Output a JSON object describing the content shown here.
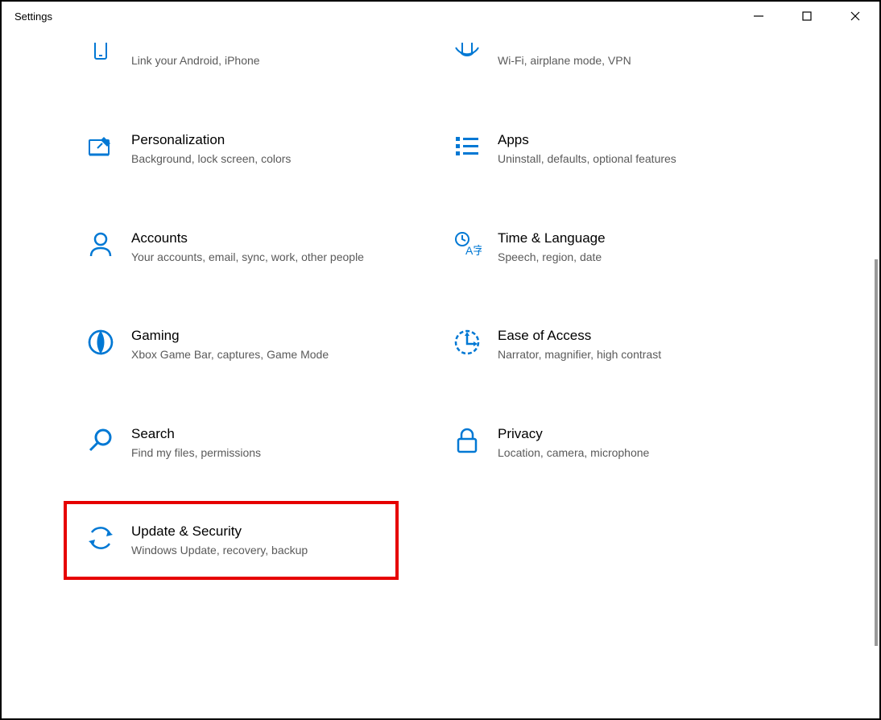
{
  "window": {
    "title": "Settings"
  },
  "tiles": [
    {
      "title": "",
      "desc": "Link your Android, iPhone"
    },
    {
      "title": "",
      "desc": "Wi-Fi, airplane mode, VPN"
    },
    {
      "title": "Personalization",
      "desc": "Background, lock screen, colors"
    },
    {
      "title": "Apps",
      "desc": "Uninstall, defaults, optional features"
    },
    {
      "title": "Accounts",
      "desc": "Your accounts, email, sync, work, other people"
    },
    {
      "title": "Time & Language",
      "desc": "Speech, region, date"
    },
    {
      "title": "Gaming",
      "desc": "Xbox Game Bar, captures, Game Mode"
    },
    {
      "title": "Ease of Access",
      "desc": "Narrator, magnifier, high contrast"
    },
    {
      "title": "Search",
      "desc": "Find my files, permissions"
    },
    {
      "title": "Privacy",
      "desc": "Location, camera, microphone"
    },
    {
      "title": "Update & Security",
      "desc": "Windows Update, recovery, backup"
    }
  ]
}
